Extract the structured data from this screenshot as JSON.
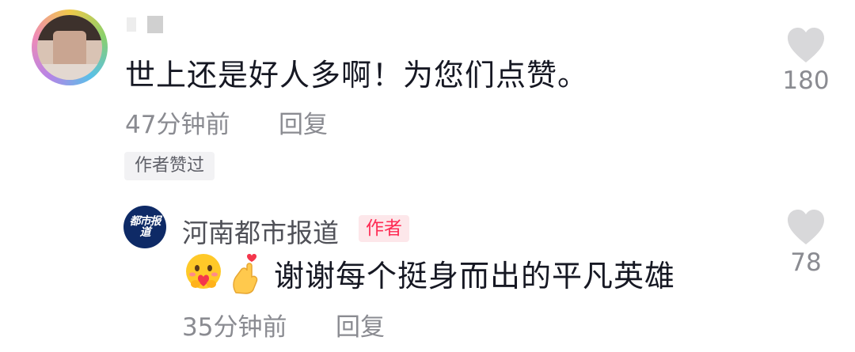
{
  "comment": {
    "text": "世上还是好人多啊！为您们点赞。",
    "time": "47分钟前",
    "reply_label": "回复",
    "author_liked_badge": "作者赞过",
    "like_count": "180",
    "avatar_icon": "user-avatar-blurred"
  },
  "reply": {
    "author_name": "河南都市报道",
    "author_tag": "作者",
    "text": "谢谢每个挺身而出的平凡英雄",
    "emojis": [
      "smiling-face-holding-heart-emoji",
      "finger-heart-hand-emoji"
    ],
    "time": "35分钟前",
    "reply_label": "回复",
    "like_count": "78",
    "avatar_logo": "都市报道"
  },
  "colors": {
    "primary_text": "#161823",
    "secondary_text": "#8a8b91",
    "author_tag_text": "#fe2c55",
    "author_tag_bg": "#fde7ea",
    "heart": "#d8d8da"
  }
}
